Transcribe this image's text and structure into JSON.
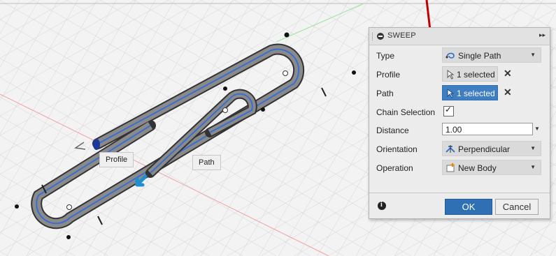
{
  "dialog": {
    "title": "SWEEP",
    "rows": [
      {
        "label": "Type",
        "value": "Single Path",
        "icon": "single-path-icon"
      },
      {
        "label": "Profile",
        "value": "1 selected",
        "icon": "cursor-arrow-icon"
      },
      {
        "label": "Path",
        "value": "1 selected",
        "icon": "cursor-arrow-icon"
      },
      {
        "label": "Chain Selection",
        "value": "✓"
      },
      {
        "label": "Distance",
        "value": "1.00"
      },
      {
        "label": "Orientation",
        "value": "Perpendicular",
        "icon": "perpendicular-icon"
      },
      {
        "label": "Operation",
        "value": "New Body",
        "icon": "new-body-icon"
      }
    ],
    "ok_label": "OK",
    "cancel_label": "Cancel",
    "clear_symbol": "✕"
  },
  "viewport": {
    "profile_tag": "Profile",
    "path_tag": "Path"
  },
  "colors": {
    "accent": "#3f7ec0",
    "annotation_arrow": "#c00000",
    "clip_highlight": "#3a6fd0"
  }
}
